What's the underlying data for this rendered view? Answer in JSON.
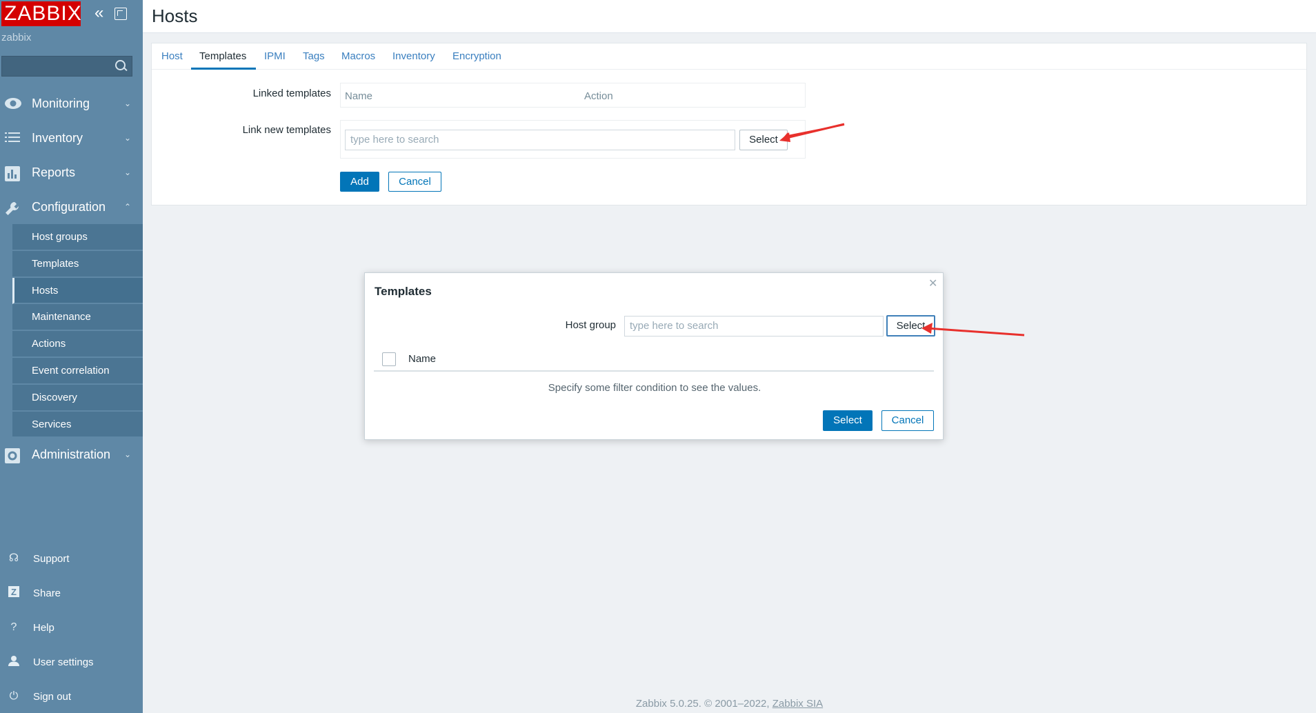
{
  "sidebar": {
    "logo": "ZABBIX",
    "server_name": "zabbix",
    "search_placeholder": "",
    "sections": [
      {
        "label": "Monitoring"
      },
      {
        "label": "Inventory"
      },
      {
        "label": "Reports"
      },
      {
        "label": "Configuration"
      },
      {
        "label": "Administration"
      }
    ],
    "config_items": [
      {
        "label": "Host groups"
      },
      {
        "label": "Templates"
      },
      {
        "label": "Hosts"
      },
      {
        "label": "Maintenance"
      },
      {
        "label": "Actions"
      },
      {
        "label": "Event correlation"
      },
      {
        "label": "Discovery"
      },
      {
        "label": "Services"
      }
    ],
    "bottom": [
      {
        "label": "Support"
      },
      {
        "label": "Share"
      },
      {
        "label": "Help"
      },
      {
        "label": "User settings"
      },
      {
        "label": "Sign out"
      }
    ]
  },
  "page": {
    "title": "Hosts",
    "tabs": [
      {
        "label": "Host"
      },
      {
        "label": "Templates"
      },
      {
        "label": "IPMI"
      },
      {
        "label": "Tags"
      },
      {
        "label": "Macros"
      },
      {
        "label": "Inventory"
      },
      {
        "label": "Encryption"
      }
    ],
    "active_tab": "Templates",
    "linked_templates_label": "Linked templates",
    "linked_cols": {
      "name": "Name",
      "action": "Action"
    },
    "link_new_label": "Link new templates",
    "link_new_placeholder": "type here to search",
    "select_button": "Select",
    "add_button": "Add",
    "cancel_button": "Cancel"
  },
  "modal": {
    "title": "Templates",
    "host_group_label": "Host group",
    "host_group_placeholder": "type here to search",
    "select_button": "Select",
    "col_name": "Name",
    "empty_message": "Specify some filter condition to see the values.",
    "footer_select": "Select",
    "footer_cancel": "Cancel"
  },
  "footer": {
    "text": "Zabbix 5.0.25. © 2001–2022,",
    "link": "Zabbix SIA"
  },
  "colors": {
    "sidebar_bg": "#5f88a6",
    "logo_bg": "#d40000",
    "primary": "#0275b8",
    "annotation_arrow": "#e8302c"
  }
}
